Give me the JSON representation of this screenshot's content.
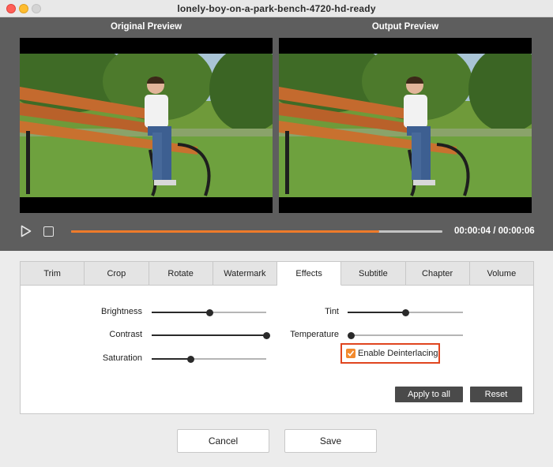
{
  "window": {
    "title": "lonely-boy-on-a-park-bench-4720-hd-ready"
  },
  "preview": {
    "original_label": "Original Preview",
    "output_label": "Output  Preview",
    "timecode": "00:00:04 / 00:00:06",
    "progress_fraction": 0.83,
    "buffered_fraction": 1.0
  },
  "tabs": [
    {
      "label": "Trim",
      "active": false
    },
    {
      "label": "Crop",
      "active": false
    },
    {
      "label": "Rotate",
      "active": false
    },
    {
      "label": "Watermark",
      "active": false
    },
    {
      "label": "Effects",
      "active": true
    },
    {
      "label": "Subtitle",
      "active": false
    },
    {
      "label": "Chapter",
      "active": false
    },
    {
      "label": "Volume",
      "active": false
    }
  ],
  "effects": {
    "brightness": {
      "label": "Brightness",
      "value": 0.5
    },
    "contrast": {
      "label": "Contrast",
      "value": 1.0
    },
    "saturation": {
      "label": "Saturation",
      "value": 0.34
    },
    "tint": {
      "label": "Tint",
      "value": 0.5
    },
    "temperature": {
      "label": "Temperature",
      "value": 0.0
    },
    "deinterlacing": {
      "label": "Enable Deinterlacing",
      "checked": true
    },
    "apply_all_label": "Apply to all",
    "reset_label": "Reset"
  },
  "footer": {
    "cancel_label": "Cancel",
    "save_label": "Save"
  },
  "colors": {
    "accent": "#ee7b2a",
    "highlight_border": "#e0451f"
  }
}
